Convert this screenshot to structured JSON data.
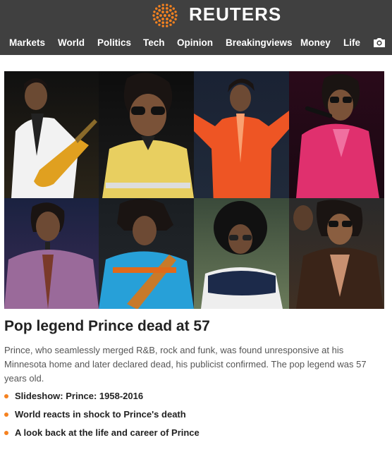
{
  "brand": {
    "name": "REUTERS",
    "accent": "#f58220",
    "masthead_bg": "#404040"
  },
  "nav": {
    "items": [
      "Markets",
      "World",
      "Politics",
      "Tech",
      "Opinion",
      "Breakingviews",
      "Money",
      "Life"
    ],
    "camera_icon": "camera-icon"
  },
  "hero": {
    "tiles": [
      "prince-guitar-white",
      "prince-sunglasses-yellow",
      "prince-orange-suit",
      "prince-pink-mic",
      "prince-purple-mic",
      "prince-blue-guitar",
      "prince-afro",
      "prince-sunglasses-fur"
    ]
  },
  "story": {
    "headline": "Pop legend Prince dead at 57",
    "summary": "Prince, who seamlessly merged R&B, rock and funk, was found unresponsive at his Minnesota home and later declared dead, his publicist confirmed. The pop legend was 57 years old.",
    "links": [
      "Slideshow: Prince: 1958-2016",
      "World reacts in shock to Prince's death",
      "A look back at the life and career of Prince"
    ]
  }
}
